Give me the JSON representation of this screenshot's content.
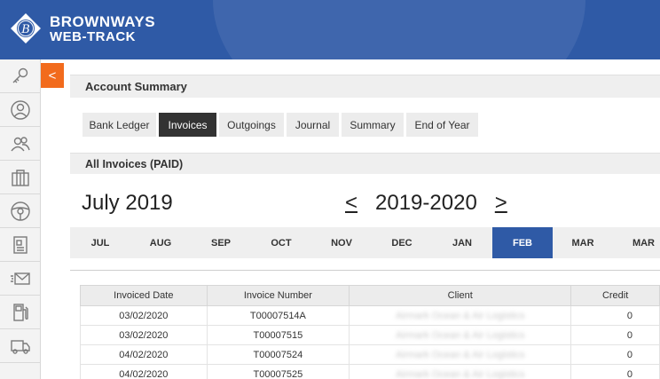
{
  "header": {
    "brand_line1": "BROWNWAYS",
    "brand_line2": "WEB-TRACK",
    "badge_letter": "B",
    "color": "#2f5aa6"
  },
  "sidebar": {
    "items": [
      {
        "icon": "key-icon"
      },
      {
        "icon": "user-icon"
      },
      {
        "icon": "users-icon"
      },
      {
        "icon": "building-icon"
      },
      {
        "icon": "steering-wheel-icon"
      },
      {
        "icon": "document-icon"
      },
      {
        "icon": "mail-icon"
      },
      {
        "icon": "fuel-pump-icon"
      },
      {
        "icon": "truck-icon"
      }
    ],
    "collapse_label": "<",
    "collapse_color": "#f26b1d"
  },
  "account_summary": {
    "title": "Account Summary",
    "tabs": [
      {
        "label": "Bank Ledger",
        "active": false
      },
      {
        "label": "Invoices",
        "active": true
      },
      {
        "label": "Outgoings",
        "active": false
      },
      {
        "label": "Journal",
        "active": false
      },
      {
        "label": "Summary",
        "active": false
      },
      {
        "label": "End of Year",
        "active": false
      }
    ]
  },
  "invoices": {
    "section_title": "All Invoices (PAID)",
    "month_title": "July 2019",
    "prev_label": "<",
    "year_label": "2019-2020",
    "next_label": ">",
    "months": [
      {
        "label": "JUL",
        "active": false
      },
      {
        "label": "AUG",
        "active": false
      },
      {
        "label": "SEP",
        "active": false
      },
      {
        "label": "OCT",
        "active": false
      },
      {
        "label": "NOV",
        "active": false
      },
      {
        "label": "DEC",
        "active": false
      },
      {
        "label": "JAN",
        "active": false
      },
      {
        "label": "FEB",
        "active": true
      },
      {
        "label": "MAR",
        "active": false
      },
      {
        "label": "MAR",
        "active": false
      }
    ],
    "columns": [
      "Invoiced Date",
      "Invoice Number",
      "Client",
      "Credit"
    ],
    "rows": [
      {
        "date": "03/02/2020",
        "number": "T00007514A",
        "client": "Airmark Ocean & Air Logistics",
        "credit": "0"
      },
      {
        "date": "03/02/2020",
        "number": "T00007515",
        "client": "Airmark Ocean & Air Logistics",
        "credit": "0"
      },
      {
        "date": "04/02/2020",
        "number": "T00007524",
        "client": "Airmark Ocean & Air Logistics",
        "credit": "0"
      },
      {
        "date": "04/02/2020",
        "number": "T00007525",
        "client": "Airmark Ocean & Air Logistics",
        "credit": "0"
      }
    ]
  }
}
